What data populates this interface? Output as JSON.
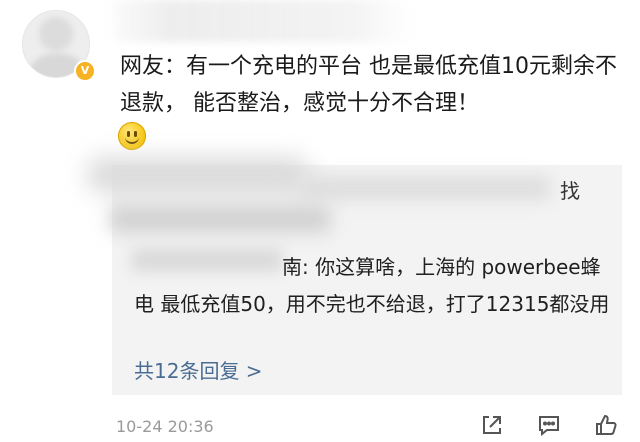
{
  "comment": {
    "avatar_badge": "V",
    "text": "网友：有一个充电的平台 也是最低充值10元剩余不退款，   能否整治，感觉十分不合理！",
    "emoji": "smile-emoji"
  },
  "replies": [
    {
      "visible_fragment": "找",
      "obscured": true
    },
    {
      "author_suffix": "南: ",
      "text": "你这算啥，上海的 powerbee蜂电 最低充值50，用不完也不给退，打了12315都没用"
    }
  ],
  "more_replies_label": "共12条回复 >",
  "timestamp": "10-24 20:36",
  "actions": {
    "share_icon": "share-icon",
    "comment_icon": "comment-icon",
    "like_icon": "like-icon"
  },
  "colors": {
    "link": "#4a6c93",
    "reply_bg": "#f3f3f3",
    "badge": "#f6b222",
    "timestamp": "#9a9a9a"
  }
}
